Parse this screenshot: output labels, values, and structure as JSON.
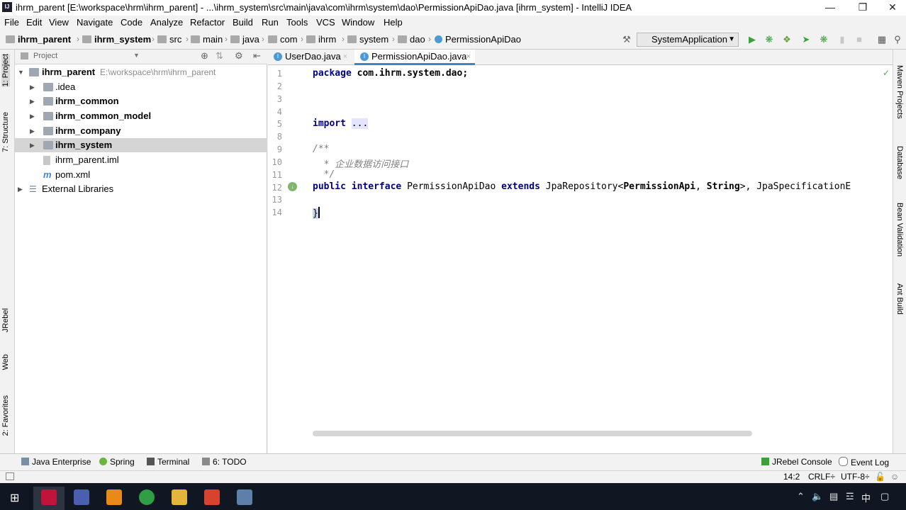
{
  "window": {
    "title": "ihrm_parent [E:\\workspace\\hrm\\ihrm_parent] - ...\\ihrm_system\\src\\main\\java\\com\\ihrm\\system\\dao\\PermissionApiDao.java [ihrm_system] - IntelliJ IDEA",
    "app_icon": "IJ"
  },
  "menu": [
    "File",
    "Edit",
    "View",
    "Navigate",
    "Code",
    "Analyze",
    "Refactor",
    "Build",
    "Run",
    "Tools",
    "VCS",
    "Window",
    "Help"
  ],
  "breadcrumbs": [
    "ihrm_parent",
    "ihrm_system",
    "src",
    "main",
    "java",
    "com",
    "ihrm",
    "system",
    "dao",
    "PermissionApiDao"
  ],
  "run_config": "SystemApplication",
  "left_tabs": [
    "1: Project",
    "7: Structure",
    "JRebel",
    "Web",
    "2: Favorites"
  ],
  "right_tabs": [
    "Maven Projects",
    "Database",
    "Bean Validation",
    "Ant Build"
  ],
  "project": {
    "header": "Project",
    "root": {
      "name": "ihrm_parent",
      "path": "E:\\workspace\\hrm\\ihrm_parent"
    },
    "items": [
      ".idea",
      "ihrm_common",
      "ihrm_common_model",
      "ihrm_company",
      "ihrm_system",
      "ihrm_parent.iml",
      "pom.xml"
    ],
    "external": "External Libraries"
  },
  "editor": {
    "tabs": [
      "UserDao.java",
      "PermissionApiDao.java"
    ],
    "line_numbers": [
      "1",
      "2",
      "3",
      "4",
      "5",
      "8",
      "9",
      "10",
      "11",
      "12",
      "13",
      "14"
    ],
    "code": {
      "pkg_kw": "package",
      "pkg_name": " com.ihrm.system.dao;",
      "import_kw": "import",
      "import_fold": "...",
      "doc_open": "/**",
      "doc_text": "  * 企业数据访问接口",
      "doc_close": "  */",
      "l12_public": "public",
      "l12_interface": "interface",
      "l12_name": " PermissionApiDao ",
      "l12_extends": "extends",
      "l12_rest1": " JpaRepository<",
      "l12_type1": "PermissionApi",
      "l12_rest2": ", ",
      "l12_type2": "String",
      "l12_rest3": ">, JpaSpecificationE",
      "brace": "}"
    }
  },
  "bottom_tools": [
    "Java Enterprise",
    "Spring",
    "Terminal",
    "6: TODO",
    "JRebel Console",
    "Event Log"
  ],
  "status": {
    "position": "14:2",
    "line_sep": "CRLF÷",
    "encoding": "UTF-8÷"
  },
  "tray": {
    "ime": "中"
  }
}
